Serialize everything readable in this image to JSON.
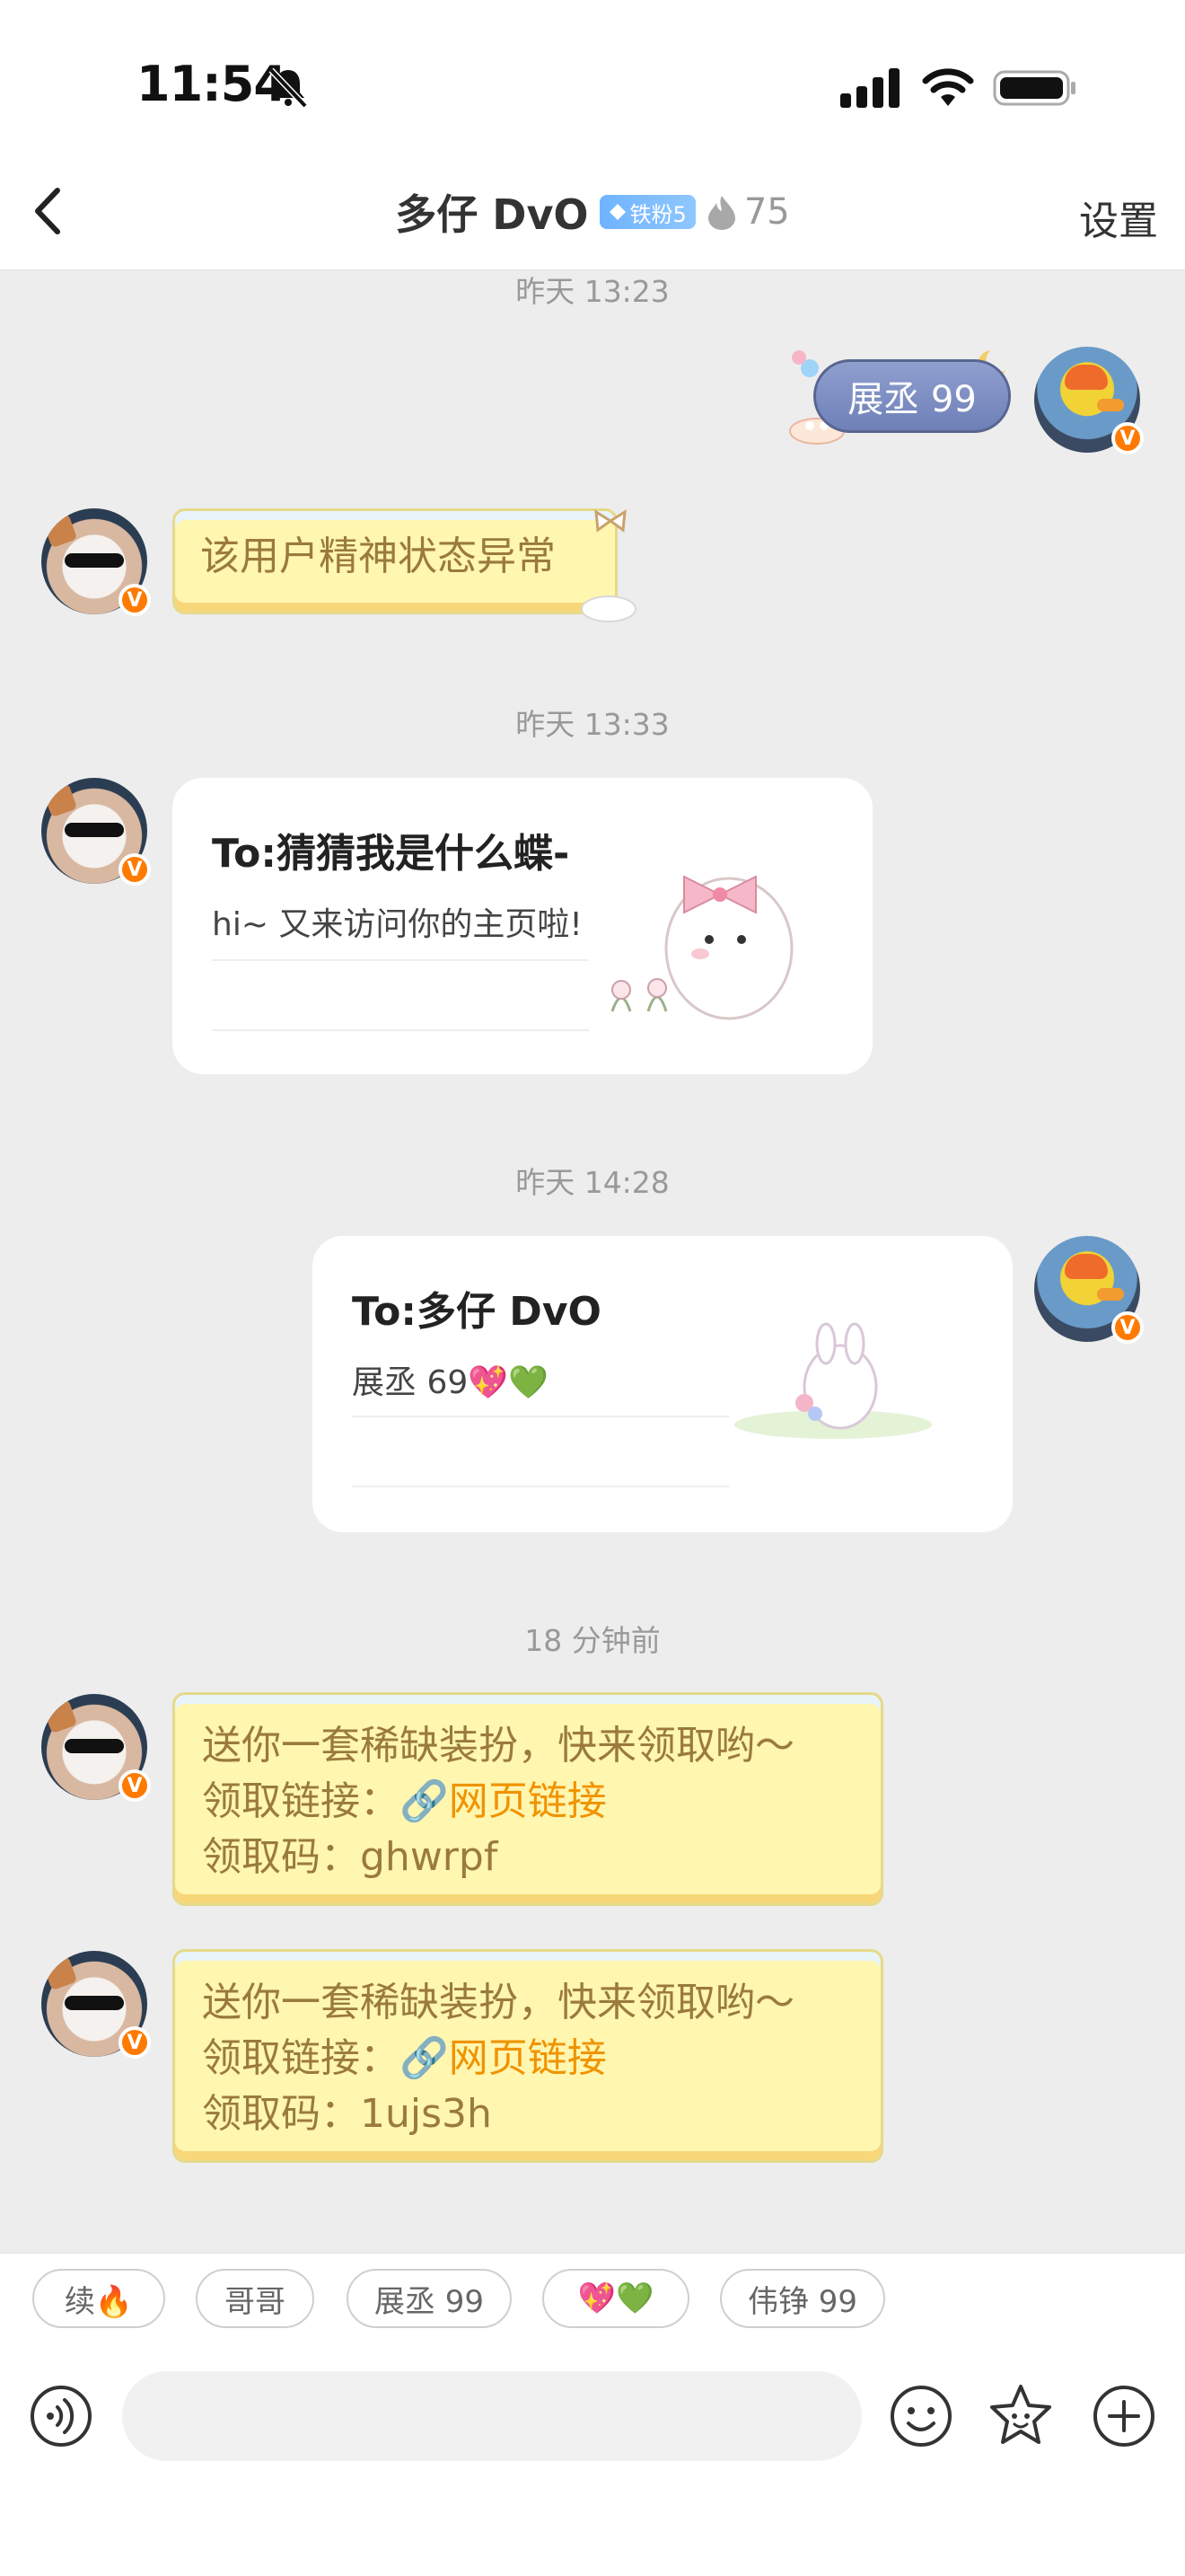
{
  "status": {
    "time": "11:54"
  },
  "header": {
    "title": "多仔 DvO",
    "fan_badge": "铁粉5",
    "flame_count": "75",
    "settings_label": "设置"
  },
  "messages": {
    "t1": "昨天 13:23",
    "m1_text": "展丞 99",
    "m2_text": "该用户精神状态异常",
    "t2": "昨天 13:33",
    "card1": {
      "title": "To:猜猜我是什么蝶-",
      "subtitle": "hi~ 又来访问你的主页啦!"
    },
    "t3": "昨天 14:28",
    "card2": {
      "title": "To:多仔 DvO",
      "subtitle": "展丞 69💖💚"
    },
    "t4": "18 分钟前",
    "gift1": {
      "line1": "送你一套稀缺装扮，快来领取哟～",
      "line2_label": "领取链接：",
      "link": "网页链接",
      "line3_label": "领取码：",
      "code": "ghwrpf"
    },
    "gift2": {
      "line1": "送你一套稀缺装扮，快来领取哟～",
      "line2_label": "领取链接：",
      "link": "网页链接",
      "line3_label": "领取码：",
      "code": "1ujs3h"
    }
  },
  "quick_replies": [
    "续🔥",
    "哥哥",
    "展丞 99",
    "💖💚",
    "伟铮 99"
  ],
  "input": {
    "placeholder": ""
  },
  "colors": {
    "accent": "#f09300",
    "scroll_text": "#9a7a3e",
    "badge": "#6fb3ff",
    "avatar_badge": "#ff7a00"
  }
}
